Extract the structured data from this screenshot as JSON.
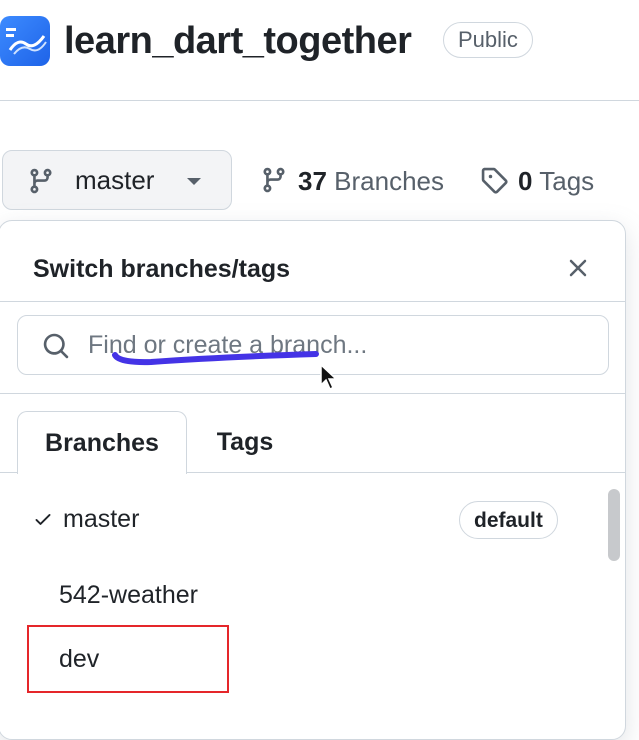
{
  "header": {
    "repo_name": "learn_dart_together",
    "visibility": "Public"
  },
  "branch_selector": {
    "current_branch": "master"
  },
  "stats": {
    "branches_count": "37",
    "branches_label": "Branches",
    "tags_count": "0",
    "tags_label": "Tags"
  },
  "popover": {
    "title": "Switch branches/tags",
    "search_placeholder": "Find or create a branch...",
    "tabs": [
      {
        "label": "Branches",
        "active": true
      },
      {
        "label": "Tags",
        "active": false
      }
    ],
    "branches": [
      {
        "name": "master",
        "selected": true,
        "badge": "default"
      },
      {
        "name": "542-weather",
        "selected": false,
        "badge": ""
      },
      {
        "name": "dev",
        "selected": false,
        "badge": ""
      }
    ]
  },
  "colors": {
    "annotation_underline": "#4433e6",
    "highlight_box": "#e5262a",
    "avatar": "#2f7bf5"
  },
  "icons": {
    "branch": "git-branch-icon",
    "tag": "tag-icon",
    "search": "search-icon",
    "close": "close-icon",
    "check": "check-icon",
    "caret": "caret-down-icon"
  }
}
